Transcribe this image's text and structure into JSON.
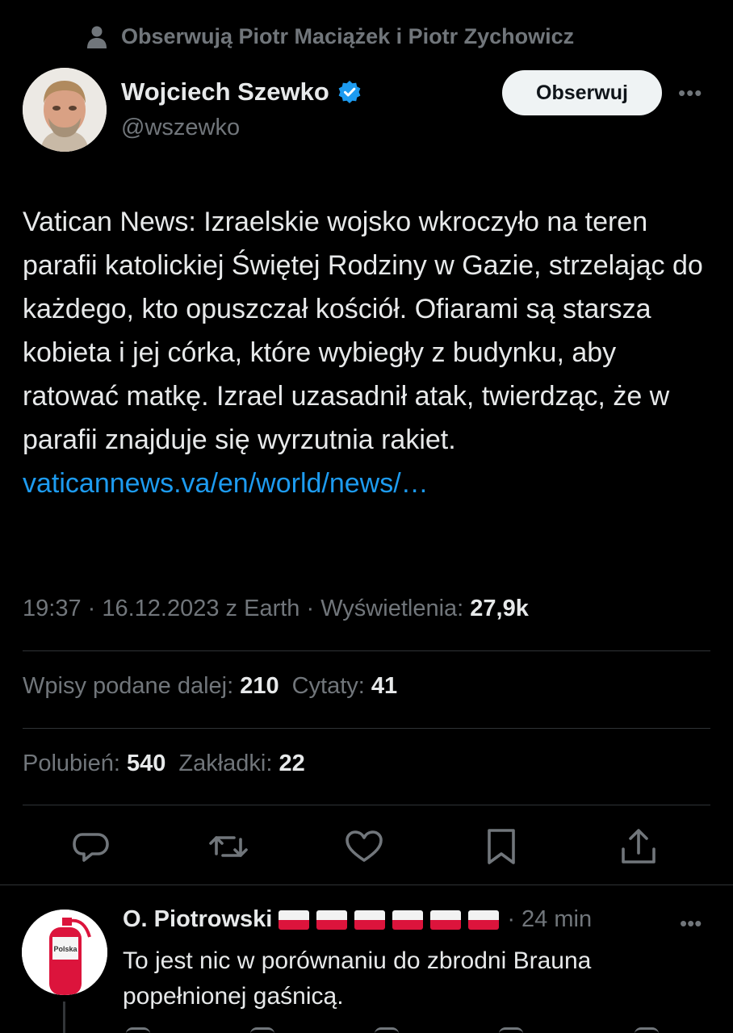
{
  "social_context": {
    "icon": "person-icon",
    "text": "Obserwują Piotr Maciążek i Piotr Zychowicz"
  },
  "author": {
    "name": "Wojciech Szewko",
    "handle": "@wszewko",
    "verified_icon": "verified-badge-icon",
    "follow_label": "Obserwuj",
    "more_icon": "more-icon"
  },
  "tweet": {
    "text": "Vatican News: Izraelskie wojsko wkroczyło na teren parafii katolickiej Świętej Rodziny w Gazie, strzelając do każdego, kto opuszczał kościół. Ofiarami są starsza kobieta i jej córka, które wybiegły z budynku, aby ratować matkę. Izrael uzasadnił atak, twierdząc, że w parafii znajduje się wyrzutnia rakiet.",
    "link": "vaticannews.va/en/world/news/…",
    "link_color": "#1d9bf0"
  },
  "meta": {
    "time_date": "19:37 · 16.12.2023 z Earth · ",
    "views_label": "Wyświetlenia: ",
    "views_value": "27,9k"
  },
  "stats": {
    "reposts_label": "Wpisy podane dalej: ",
    "reposts_value": "210",
    "quotes_label": "Cytaty: ",
    "quotes_value": "41",
    "likes_label": "Polubień: ",
    "likes_value": "540",
    "bookmarks_label": "Zakładki: ",
    "bookmarks_value": "22"
  },
  "actions": [
    "reply-icon",
    "repost-icon",
    "like-icon",
    "bookmark-icon",
    "share-icon"
  ],
  "reply": {
    "name": "O. Piotrowski",
    "flag_count": 6,
    "time": "· 24 min",
    "text": "To jest nic w porównaniu do zbrodni Brauna popełnionej gaśnicą.",
    "avatar_label": "Polska"
  },
  "colors": {
    "background": "#000000",
    "text": "#e7e9ea",
    "muted": "#71767b",
    "accent": "#1d9bf0",
    "flag_red": "#dc143c"
  }
}
